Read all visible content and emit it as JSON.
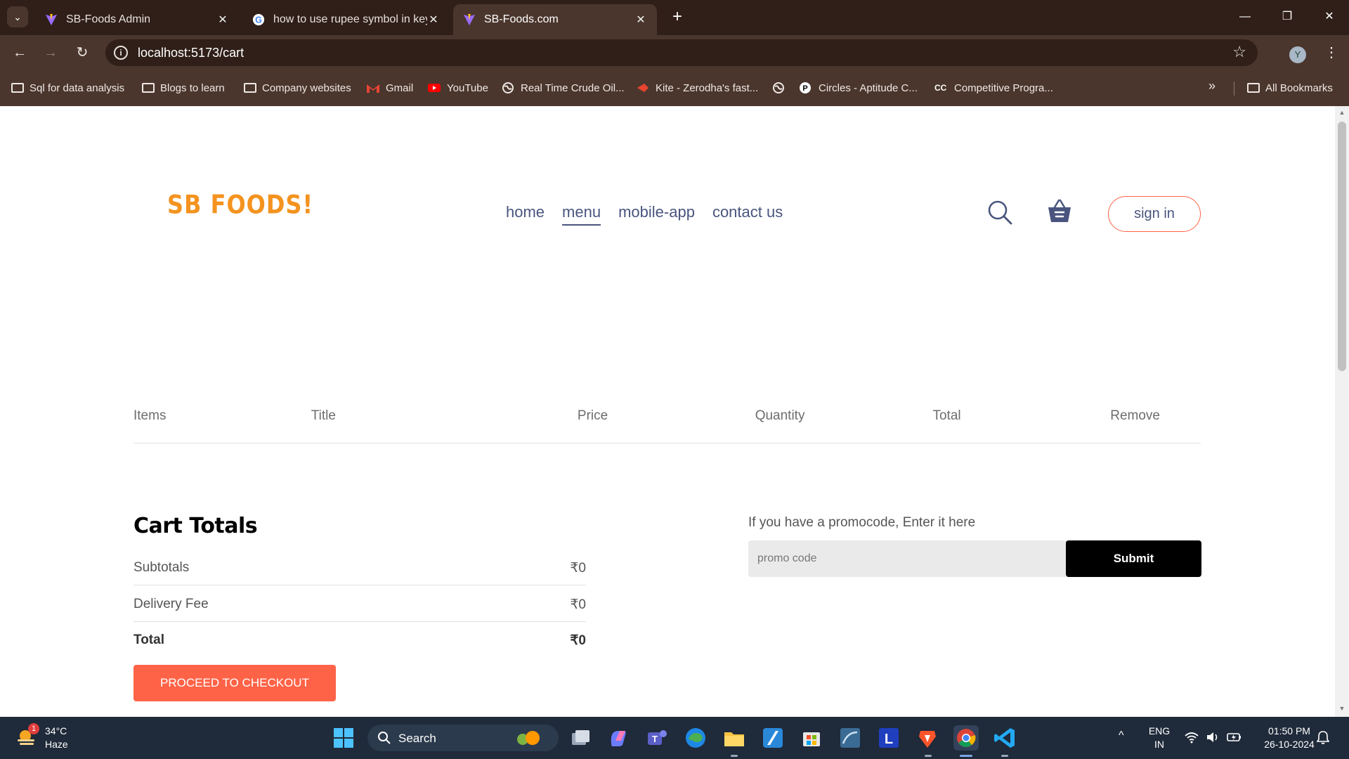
{
  "browser": {
    "tabs": [
      {
        "title": "SB-Foods Admin",
        "active": false
      },
      {
        "title": "how to use rupee symbol in key",
        "active": false
      },
      {
        "title": "SB-Foods.com",
        "active": true
      }
    ],
    "url": "localhost:5173/cart",
    "profile_initial": "Y",
    "bookmarks": [
      {
        "label": "Sql for data analysis",
        "icon": "folder-icon"
      },
      {
        "label": "Blogs to learn",
        "icon": "folder-icon"
      },
      {
        "label": "Company websites",
        "icon": "folder-icon"
      },
      {
        "label": "Gmail",
        "icon": "gmail-icon"
      },
      {
        "label": "YouTube",
        "icon": "youtube-icon"
      },
      {
        "label": "Real Time Crude Oil...",
        "icon": "globe-icon"
      },
      {
        "label": "Kite - Zerodha's fast...",
        "icon": "kite-icon"
      },
      {
        "label": "",
        "icon": "globe-icon"
      },
      {
        "label": "Circles - Aptitude C...",
        "icon": "circles-icon"
      },
      {
        "label": "Competitive Progra...",
        "icon": "codechef-icon"
      }
    ],
    "all_bookmarks": "All Bookmarks"
  },
  "site": {
    "logo": "SB FOODS!",
    "nav": [
      "home",
      "menu",
      "mobile-app",
      "contact us"
    ],
    "active_nav": "menu",
    "signin": "sign in"
  },
  "cart": {
    "headers": [
      "Items",
      "Title",
      "Price",
      "Quantity",
      "Total",
      "Remove"
    ]
  },
  "totals": {
    "title": "Cart Totals",
    "rows": [
      {
        "label": "Subtotals",
        "value": "₹0"
      },
      {
        "label": "Delivery Fee",
        "value": "₹0"
      },
      {
        "label": "Total",
        "value": "₹0"
      }
    ],
    "checkout": "PROCEED TO CHECKOUT"
  },
  "promo": {
    "label": "If you have a promocode, Enter it here",
    "placeholder": "promo code",
    "submit": "Submit"
  },
  "taskbar": {
    "weather_temp": "34°C",
    "weather_desc": "Haze",
    "weather_badge": "1",
    "search": "Search",
    "lang1": "ENG",
    "lang2": "IN",
    "time": "01:50 PM",
    "date": "26-10-2024"
  },
  "colors": {
    "accent": "#ff6347",
    "nav_text": "#49557e",
    "logo": "#f4931f"
  }
}
